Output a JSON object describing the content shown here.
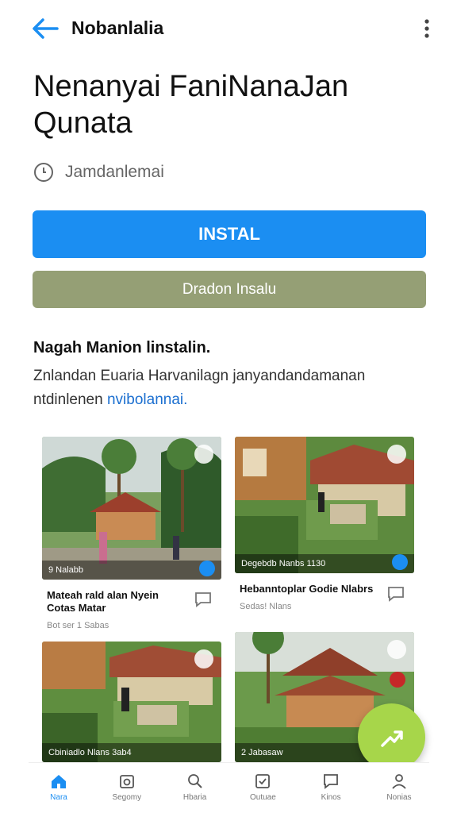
{
  "header": {
    "title": "Nobanlalia"
  },
  "app": {
    "title": "Nenanyai FaniNanaJan Qunata",
    "meta": "Jamdanlemai"
  },
  "buttons": {
    "install": "INSTAL",
    "secondary": "Dradon Insalu"
  },
  "section": {
    "heading": "Nagah Manion linstalin.",
    "desc_main": "Znlandan Euaria Harvanilagn janyandandamanan",
    "desc_prefix": "ntdinlenen",
    "desc_link": "nvibolannai."
  },
  "cards": [
    {
      "caption": "9 Nalabb",
      "title": "Mateah rald alan Nyein Cotas Matar",
      "sub": "Bot ser 1 Sabas"
    },
    {
      "caption": "Degebdb Nanbs 1130",
      "title": "Hebanntoplar Godie Nlabrs",
      "sub": "Sedas! Nlans"
    },
    {
      "caption": "Cbiniadlo Nlans 3ab4",
      "title": "",
      "sub": ""
    },
    {
      "caption": "2 Jabasaw",
      "title": "",
      "sub": ""
    }
  ],
  "nav": [
    {
      "label": "Nara",
      "icon": "home-icon"
    },
    {
      "label": "Segomy",
      "icon": "camera-icon"
    },
    {
      "label": "Hbaria",
      "icon": "search-icon"
    },
    {
      "label": "Outuae",
      "icon": "checklist-icon"
    },
    {
      "label": "Kinos",
      "icon": "chat-search-icon"
    },
    {
      "label": "Nonias",
      "icon": "profile-icon"
    }
  ],
  "colors": {
    "accent": "#1b8ef2",
    "secondary": "#959f75",
    "fab": "#a7d64a"
  }
}
